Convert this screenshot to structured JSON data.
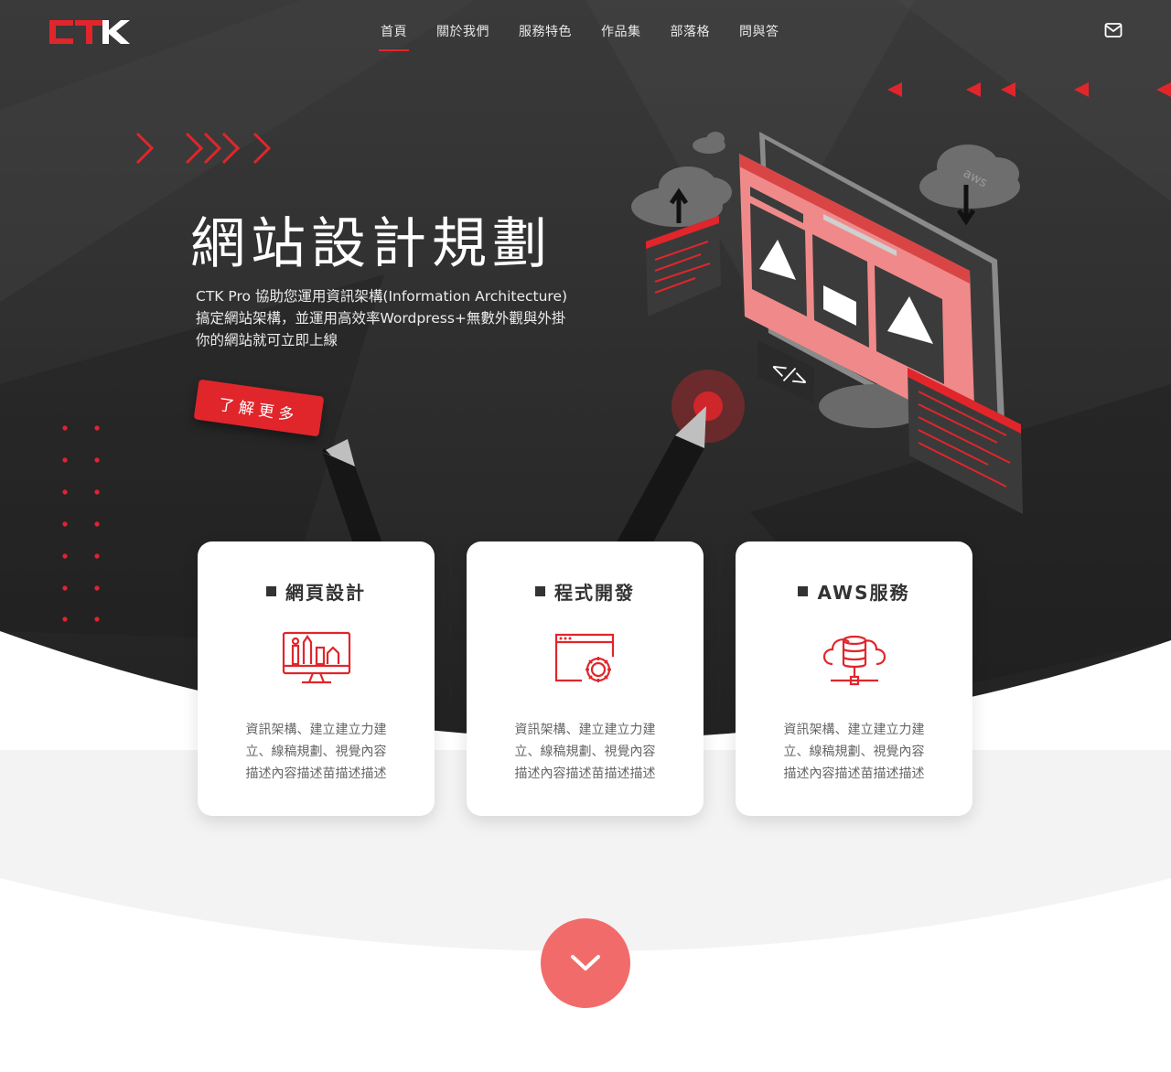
{
  "brand": {
    "logo_text": "CTK",
    "accent": "#e0262b",
    "dark_bg": "#2e2e2e"
  },
  "nav": {
    "items": [
      {
        "label": "首頁",
        "active": true
      },
      {
        "label": "關於我們",
        "active": false
      },
      {
        "label": "服務特色",
        "active": false
      },
      {
        "label": "作品集",
        "active": false
      },
      {
        "label": "部落格",
        "active": false
      },
      {
        "label": "問與答",
        "active": false
      }
    ],
    "mail_icon": "mail-icon"
  },
  "hero": {
    "title": "網站設計規劃",
    "desc_lines": [
      "CTK Pro 協助您運用資訊架構(Information Architecture)",
      "搞定網站架構，並運用高效率Wordpress+無數外觀與外掛",
      "你的網站就可立即上線"
    ],
    "cta_label": "了解更多",
    "cloud_label": "aws"
  },
  "services": [
    {
      "title": "網頁設計",
      "icon": "web-design-icon",
      "desc_lines": [
        "資訊架構、建立建立力建",
        "立、線稿規劃、視覺內容",
        "描述內容描述苗描述描述"
      ]
    },
    {
      "title": "程式開發",
      "icon": "code-gear-icon",
      "desc_lines": [
        "資訊架構、建立建立力建",
        "立、線稿規劃、視覺內容",
        "描述內容描述苗描述描述"
      ]
    },
    {
      "title": "AWS服務",
      "icon": "cloud-database-icon",
      "desc_lines": [
        "資訊架構、建立建立力建",
        "立、線稿規劃、視覺內容",
        "描述內容描述苗描述描述"
      ]
    }
  ],
  "scroll_down_icon": "chevron-down-icon"
}
